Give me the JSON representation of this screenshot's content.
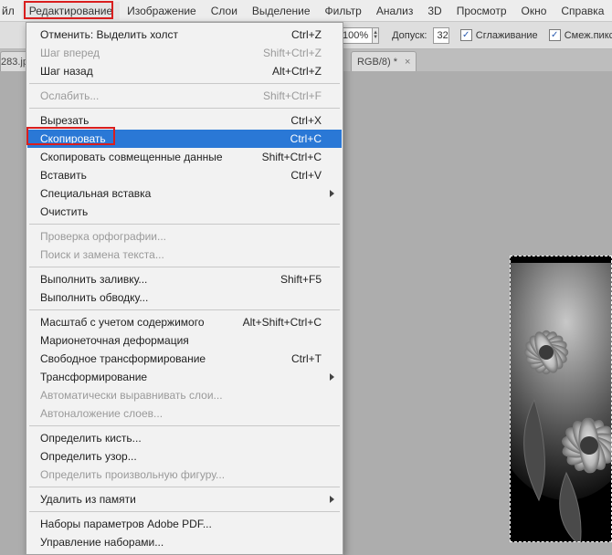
{
  "menubar": {
    "items": [
      {
        "label": "йл"
      },
      {
        "label": "Редактирование"
      },
      {
        "label": "Изображение"
      },
      {
        "label": "Слои"
      },
      {
        "label": "Выделение"
      },
      {
        "label": "Фильтр"
      },
      {
        "label": "Анализ"
      },
      {
        "label": "3D"
      },
      {
        "label": "Просмотр"
      },
      {
        "label": "Окно"
      },
      {
        "label": "Справка"
      }
    ]
  },
  "toolbar": {
    "zoom": "100%",
    "tolerance_label": "Допуск:",
    "tolerance_value": "32",
    "antialias_label": "Сглаживание",
    "contiguous_label": "Смеж.пикс"
  },
  "tabs": {
    "left": {
      "label": "283.jp",
      "close": "×"
    },
    "right": {
      "label": "RGB/8) *",
      "close": "×"
    }
  },
  "dropdown": {
    "groups": [
      [
        {
          "label": "Отменить: Выделить холст",
          "shortcut": "Ctrl+Z",
          "disabled": false
        },
        {
          "label": "Шаг вперед",
          "shortcut": "Shift+Ctrl+Z",
          "disabled": true
        },
        {
          "label": "Шаг назад",
          "shortcut": "Alt+Ctrl+Z",
          "disabled": false
        }
      ],
      [
        {
          "label": "Ослабить...",
          "shortcut": "Shift+Ctrl+F",
          "disabled": true
        }
      ],
      [
        {
          "label": "Вырезать",
          "shortcut": "Ctrl+X",
          "disabled": false
        },
        {
          "label": "Скопировать",
          "shortcut": "Ctrl+C",
          "disabled": false,
          "highlight": true
        },
        {
          "label": "Скопировать совмещенные данные",
          "shortcut": "Shift+Ctrl+C",
          "disabled": false
        },
        {
          "label": "Вставить",
          "shortcut": "Ctrl+V",
          "disabled": false
        },
        {
          "label": "Специальная вставка",
          "submenu": true,
          "disabled": false
        },
        {
          "label": "Очистить",
          "disabled": false
        }
      ],
      [
        {
          "label": "Проверка орфографии...",
          "disabled": true
        },
        {
          "label": "Поиск и замена текста...",
          "disabled": true
        }
      ],
      [
        {
          "label": "Выполнить заливку...",
          "shortcut": "Shift+F5",
          "disabled": false
        },
        {
          "label": "Выполнить обводку...",
          "disabled": false
        }
      ],
      [
        {
          "label": "Масштаб с учетом содержимого",
          "shortcut": "Alt+Shift+Ctrl+C",
          "disabled": false
        },
        {
          "label": "Марионеточная деформация",
          "disabled": false
        },
        {
          "label": "Свободное трансформирование",
          "shortcut": "Ctrl+T",
          "disabled": false
        },
        {
          "label": "Трансформирование",
          "submenu": true,
          "disabled": false
        },
        {
          "label": "Автоматически выравнивать слои...",
          "disabled": true
        },
        {
          "label": "Автоналожение слоев...",
          "disabled": true
        }
      ],
      [
        {
          "label": "Определить кисть...",
          "disabled": false
        },
        {
          "label": "Определить узор...",
          "disabled": false
        },
        {
          "label": "Определить произвольную фигуру...",
          "disabled": true
        }
      ],
      [
        {
          "label": "Удалить из памяти",
          "submenu": true,
          "disabled": false
        }
      ],
      [
        {
          "label": "Наборы параметров Adobe PDF...",
          "disabled": false
        },
        {
          "label": "Управление наборами...",
          "disabled": false
        }
      ]
    ]
  }
}
